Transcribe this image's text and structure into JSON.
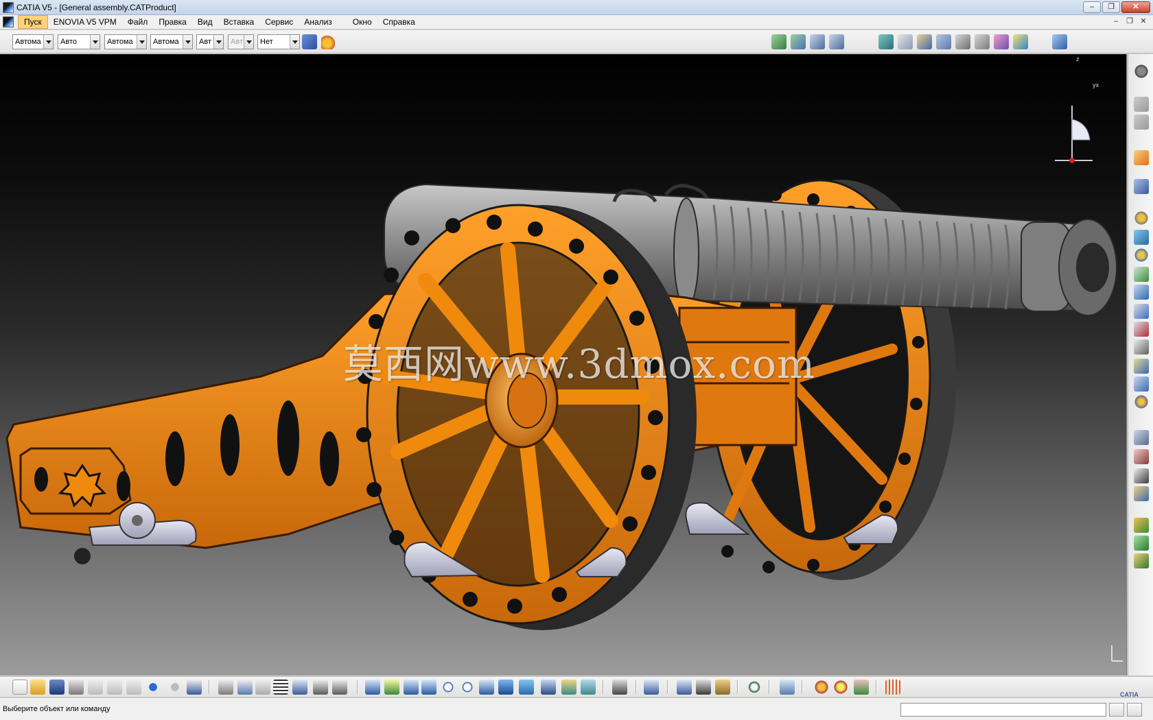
{
  "window": {
    "title": "CATIA V5 - [General assembly.CATProduct]"
  },
  "menu": {
    "items": [
      "Пуск",
      "ENOVIA V5 VPM",
      "Файл",
      "Правка",
      "Вид",
      "Вставка",
      "Сервис",
      "Анализ",
      "Окно",
      "Справка"
    ]
  },
  "format_toolbar": {
    "combos": [
      {
        "name": "color-combo",
        "value": "Автома"
      },
      {
        "name": "transparency-combo",
        "value": "Авто"
      },
      {
        "name": "line-thickness-combo",
        "value": "Автома"
      },
      {
        "name": "linetype-combo",
        "value": "Автома"
      },
      {
        "name": "point-type-combo",
        "value": "Авт"
      },
      {
        "name": "render-style-combo",
        "value": "Авт"
      },
      {
        "name": "layer-combo",
        "value": "Нет"
      }
    ]
  },
  "viewport": {
    "watermark": "莫西网www.3dmox.com",
    "background_top": "#000000",
    "background_bottom": "#9b9b9b",
    "model_color": "#f08a0c",
    "barrel_color": "#8c8c8c"
  },
  "compass": {
    "axis_z": "z",
    "axis_yx": "yx"
  },
  "statusbar": {
    "prompt": "Выберите объект или команду",
    "command_input": "",
    "brand": "CATIA"
  }
}
